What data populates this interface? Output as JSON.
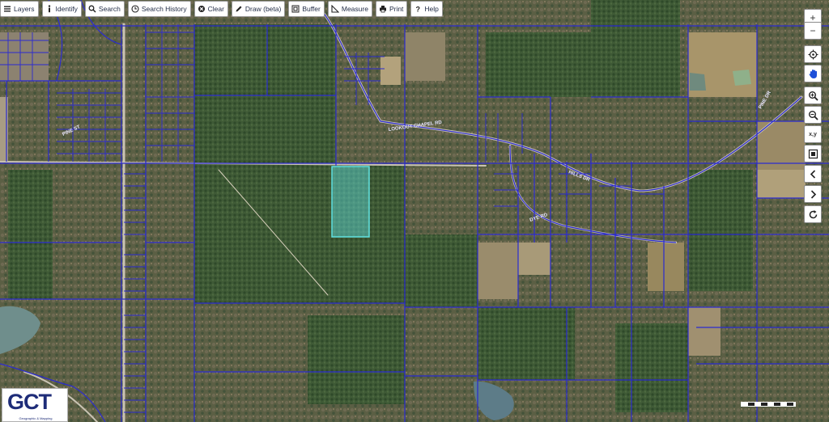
{
  "toolbar": {
    "layers": "Layers",
    "identify": "Identify",
    "search": "Search",
    "search_history": "Search History",
    "clear": "Clear",
    "draw": "Draw (beta)",
    "buffer": "Buffer",
    "measure": "Measure",
    "print": "Print",
    "help": "Help"
  },
  "map_controls": {
    "zoom_in": "+",
    "zoom_out": "−",
    "xy": "x,y"
  },
  "road_labels": {
    "road_north_left": "PINE ST",
    "road_mid": "LOOKOUT CHAPEL RD",
    "road_lower": "DYE RD",
    "road_right_a": "HILLS DR",
    "road_right_b": "PINE DR"
  },
  "logo": {
    "mark": "GCT",
    "subtitle": "Geographic & Mapping"
  },
  "colors": {
    "parcel_lines": "#2b2bd0",
    "selected_parcel": "#5fe0e0",
    "forest": "#3c5a32",
    "clearing": "#a08e6a"
  }
}
